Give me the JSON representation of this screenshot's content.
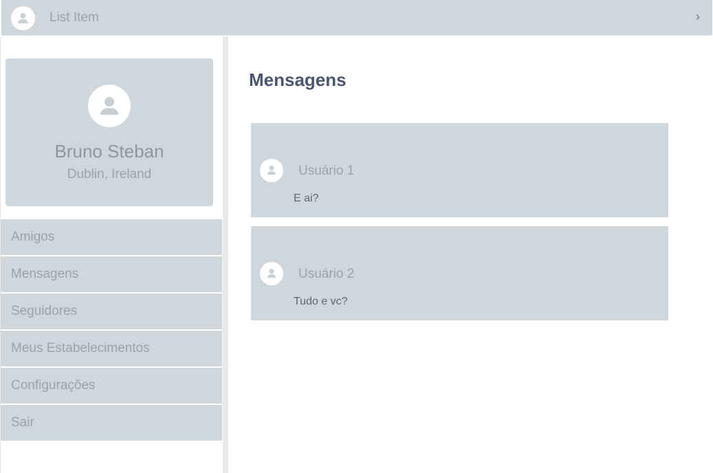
{
  "topbar": {
    "label": "List Item",
    "chevron_icon": "chevron-right-icon"
  },
  "profile": {
    "name": "Bruno Steban",
    "location": "Dublin, Ireland",
    "avatar_icon": "person-icon"
  },
  "menu": [
    {
      "label": "Amigos"
    },
    {
      "label": "Mensagens"
    },
    {
      "label": "Seguidores"
    },
    {
      "label": "Meus Estabelecimentos"
    },
    {
      "label": "Configurações"
    },
    {
      "label": "Sair"
    }
  ],
  "main": {
    "title": "Mensagens",
    "messages": [
      {
        "user": "Usuário 1",
        "text": "E ai?"
      },
      {
        "user": "Usuário 2",
        "text": "Tudo e vc?"
      }
    ]
  },
  "colors": {
    "panel": "#d0d7dc",
    "title": "#4a5670",
    "muted_text": "#9aa3a9"
  }
}
